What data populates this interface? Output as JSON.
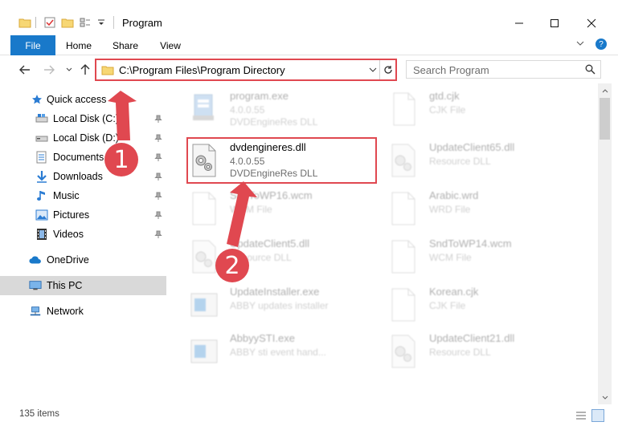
{
  "window": {
    "title": "Program",
    "controls": {
      "minimize": "minimize-icon",
      "maximize": "maximize-icon",
      "close": "close-icon"
    }
  },
  "ribbon": {
    "tabs": [
      {
        "label": "File",
        "active": true
      },
      {
        "label": "Home",
        "active": false
      },
      {
        "label": "Share",
        "active": false
      },
      {
        "label": "View",
        "active": false
      }
    ]
  },
  "address": {
    "path": "C:\\Program Files\\Program Directory",
    "search_placeholder": "Search Program"
  },
  "nav": {
    "items": [
      {
        "label": "Quick access",
        "icon": "star-icon",
        "pinned": false
      },
      {
        "label": "Local Disk (C:)",
        "icon": "drive-icon",
        "pinned": true
      },
      {
        "label": "Local Disk (D:)",
        "icon": "drive-icon",
        "pinned": true
      },
      {
        "label": "Documents",
        "icon": "documents-icon",
        "pinned": true
      },
      {
        "label": "Downloads",
        "icon": "downloads-icon",
        "pinned": true
      },
      {
        "label": "Music",
        "icon": "music-icon",
        "pinned": true
      },
      {
        "label": "Pictures",
        "icon": "pictures-icon",
        "pinned": true
      },
      {
        "label": "Videos",
        "icon": "videos-icon",
        "pinned": true
      },
      {
        "label": "OneDrive",
        "icon": "cloud-icon",
        "pinned": false
      },
      {
        "label": "This PC",
        "icon": "computer-icon",
        "pinned": false,
        "selected": true
      },
      {
        "label": "Network",
        "icon": "network-icon",
        "pinned": false
      }
    ]
  },
  "files": [
    {
      "name": "program.exe",
      "line1": "4.0.0.55",
      "line2": "DVDEngineRes DLL",
      "icon": "exe-icon",
      "faded": true
    },
    {
      "name": "gtd.cjk",
      "line1": "CJK File",
      "line2": "",
      "icon": "blank-file-icon",
      "faded": true
    },
    {
      "name": "dvdengineres.dll",
      "line1": "4.0.0.55",
      "line2": "DVDEngineRes DLL",
      "icon": "dll-gear-icon",
      "faded": false
    },
    {
      "name": "UpdateClient65.dll",
      "line1": "Resource DLL",
      "line2": "",
      "icon": "dll-gear-icon",
      "faded": true
    },
    {
      "name": "SndToWP16.wcm",
      "line1": "WCM File",
      "line2": "",
      "icon": "blank-file-icon",
      "faded": true
    },
    {
      "name": "Arabic.wrd",
      "line1": "WRD File",
      "line2": "",
      "icon": "blank-file-icon",
      "faded": true
    },
    {
      "name": "UpdateClient5.dll",
      "line1": "Resource DLL",
      "line2": "",
      "icon": "dll-gear-icon",
      "faded": true
    },
    {
      "name": "SndToWP14.wcm",
      "line1": "WCM File",
      "line2": "",
      "icon": "blank-file-icon",
      "faded": true
    },
    {
      "name": "UpdateInstaller.exe",
      "line1": "ABBY updates installer",
      "line2": "",
      "icon": "installer-icon",
      "faded": true
    },
    {
      "name": "Korean.cjk",
      "line1": "CJK File",
      "line2": "",
      "icon": "blank-file-icon",
      "faded": true
    },
    {
      "name": "AbbyySTI.exe",
      "line1": "ABBY sti event hand...",
      "line2": "",
      "icon": "installer-icon",
      "faded": true
    },
    {
      "name": "UpdateClient21.dll",
      "line1": "Resource DLL",
      "line2": "",
      "icon": "dll-gear-icon",
      "faded": true
    }
  ],
  "status": {
    "item_count": "135 items"
  },
  "annotations": [
    {
      "number": "1",
      "target": "address-bar"
    },
    {
      "number": "2",
      "target": "dvdengineres.dll"
    }
  ],
  "colors": {
    "accent": "#1979ca",
    "highlight": "#e04850",
    "selected_nav": "#d9d9d9"
  }
}
